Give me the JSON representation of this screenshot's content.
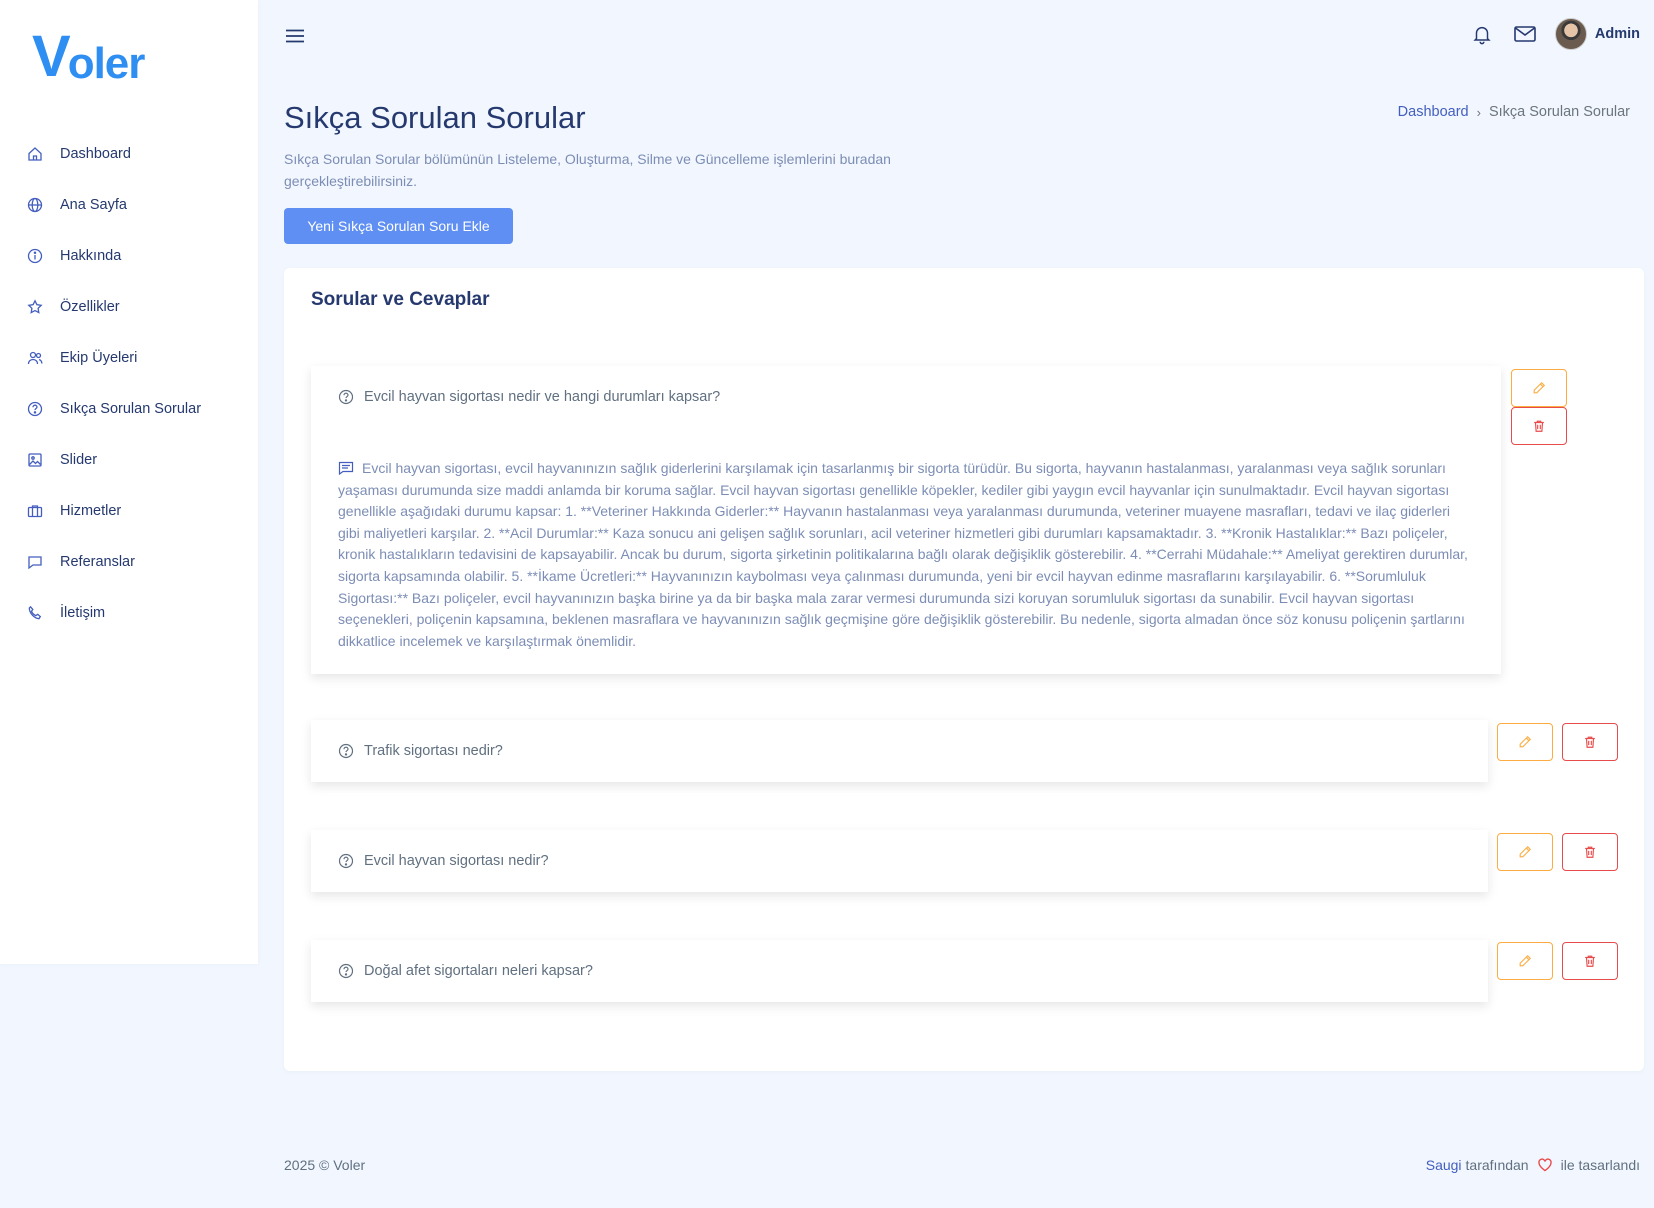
{
  "brand": {
    "logo_first": "V",
    "logo_rest": "oler"
  },
  "sidebar": {
    "items": [
      {
        "label": "Dashboard",
        "icon": "house-icon"
      },
      {
        "label": "Ana Sayfa",
        "icon": "globe-icon"
      },
      {
        "label": "Hakkında",
        "icon": "info-circle-icon"
      },
      {
        "label": "Özellikler",
        "icon": "star-icon"
      },
      {
        "label": "Ekip Üyeleri",
        "icon": "people-icon"
      },
      {
        "label": "Sıkça Sorulan Sorular",
        "icon": "question-circle-icon"
      },
      {
        "label": "Slider",
        "icon": "image-icon"
      },
      {
        "label": "Hizmetler",
        "icon": "briefcase-icon"
      },
      {
        "label": "Referanslar",
        "icon": "chat-icon"
      },
      {
        "label": "İletişim",
        "icon": "phone-icon"
      }
    ]
  },
  "topbar": {
    "user_name": "Admin",
    "icons": [
      "menu-icon",
      "bell-icon",
      "envelope-icon"
    ]
  },
  "page": {
    "title": "Sıkça Sorulan Sorular",
    "description": "Sıkça Sorulan Sorular bölümünün Listeleme, Oluşturma, Silme ve Güncelleme işlemlerini buradan gerçekleştirebilirsiniz.",
    "add_button": "Yeni Sıkça Sorulan Soru Ekle",
    "breadcrumb": {
      "home": "Dashboard",
      "separator": "›",
      "current": "Sıkça Sorulan Sorular"
    }
  },
  "card": {
    "title": "Sorular ve Cevaplar",
    "faqs": [
      {
        "question": "Evcil hayvan sigortası nedir ve hangi durumları kapsar?",
        "expanded": true,
        "answer": "Evcil hayvan sigortası, evcil hayvanınızın sağlık giderlerini karşılamak için tasarlanmış bir sigorta türüdür. Bu sigorta, hayvanın hastalanması, yaralanması veya sağlık sorunları yaşaması durumunda size maddi anlamda bir koruma sağlar. Evcil hayvan sigortası genellikle köpekler, kediler gibi yaygın evcil hayvanlar için sunulmaktadır. Evcil hayvan sigortası genellikle aşağıdaki durumu kapsar: 1. **Veteriner Hakkında Giderler:** Hayvanın hastalanması veya yaralanması durumunda, veteriner muayene masrafları, tedavi ve ilaç giderleri gibi maliyetleri karşılar. 2. **Acil Durumlar:** Kaza sonucu ani gelişen sağlık sorunları, acil veteriner hizmetleri gibi durumları kapsamaktadır. 3. **Kronik Hastalıklar:** Bazı poliçeler, kronik hastalıkların tedavisini de kapsayabilir. Ancak bu durum, sigorta şirketinin politikalarına bağlı olarak değişiklik gösterebilir. 4. **Cerrahi Müdahale:** Ameliyat gerektiren durumlar, sigorta kapsamında olabilir. 5. **İkame Ücretleri:** Hayvanınızın kaybolması veya çalınması durumunda, yeni bir evcil hayvan edinme masraflarını karşılayabilir. 6. **Sorumluluk Sigortası:** Bazı poliçeler, evcil hayvanınızın başka birine ya da bir başka mala zarar vermesi durumunda sizi koruyan sorumluluk sigortası da sunabilir. Evcil hayvan sigortası seçenekleri, poliçenin kapsamına, beklenen masraflara ve hayvanınızın sağlık geçmişine göre değişiklik gösterebilir. Bu nedenle, sigorta almadan önce söz konusu poliçenin şartlarını dikkatlice incelemek ve karşılaştırmak önemlidir."
      },
      {
        "question": "Trafik sigortası nedir?",
        "expanded": false
      },
      {
        "question": "Evcil hayvan sigortası nedir?",
        "expanded": false
      },
      {
        "question": "Doğal afet sigortaları neleri kapsar?",
        "expanded": false
      }
    ]
  },
  "footer": {
    "copyright": "2025 © Voler",
    "author": "Saugi",
    "by_text": "tarafından",
    "designed_text": "ile tasarlandı"
  },
  "colors": {
    "primary": "#435ebe",
    "button": "#5f8ff2",
    "edit": "#fdac41",
    "delete": "#e84b4b",
    "background": "#f2f7ff"
  }
}
